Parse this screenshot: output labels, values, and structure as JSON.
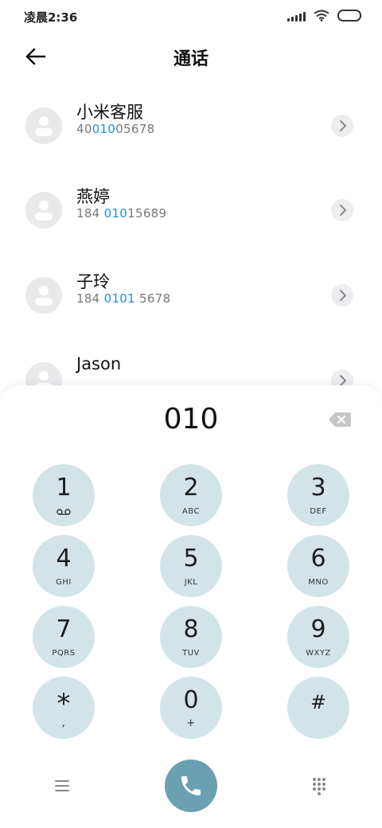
{
  "status_bar": {
    "time": "凌晨2:36"
  },
  "header": {
    "title": "通话"
  },
  "contacts": [
    {
      "name": "小米客服",
      "number_pre": "40",
      "number_hl": "010",
      "number_post": "05678"
    },
    {
      "name": "燕婷",
      "number_pre": "184 ",
      "number_hl": "010",
      "number_post": "15689"
    },
    {
      "name": "子玲",
      "number_pre": "184 ",
      "number_hl": "0101",
      "number_post": " 5678"
    },
    {
      "name": "Jason",
      "number_pre": "",
      "number_hl": "",
      "number_post": ""
    }
  ],
  "dialer": {
    "input_value": "010",
    "keys": [
      {
        "digit": "1",
        "letters": ""
      },
      {
        "digit": "2",
        "letters": "ABC"
      },
      {
        "digit": "3",
        "letters": "DEF"
      },
      {
        "digit": "4",
        "letters": "GHI"
      },
      {
        "digit": "5",
        "letters": "JKL"
      },
      {
        "digit": "6",
        "letters": "MNO"
      },
      {
        "digit": "7",
        "letters": "PQRS"
      },
      {
        "digit": "8",
        "letters": "TUV"
      },
      {
        "digit": "9",
        "letters": "WXYZ"
      },
      {
        "digit": "*",
        "letters": ","
      },
      {
        "digit": "0",
        "letters": "+"
      },
      {
        "digit": "#",
        "letters": ""
      }
    ]
  },
  "colors": {
    "highlight": "#1f8fd4",
    "key_background": "#d3e4e8",
    "call_button": "#6aa0b2"
  },
  "icons": {
    "back": "arrow-left-icon",
    "backspace": "backspace-icon",
    "voicemail": "voicemail-icon",
    "menu": "menu-icon",
    "call": "phone-icon",
    "keypad": "dialpad-icon"
  }
}
